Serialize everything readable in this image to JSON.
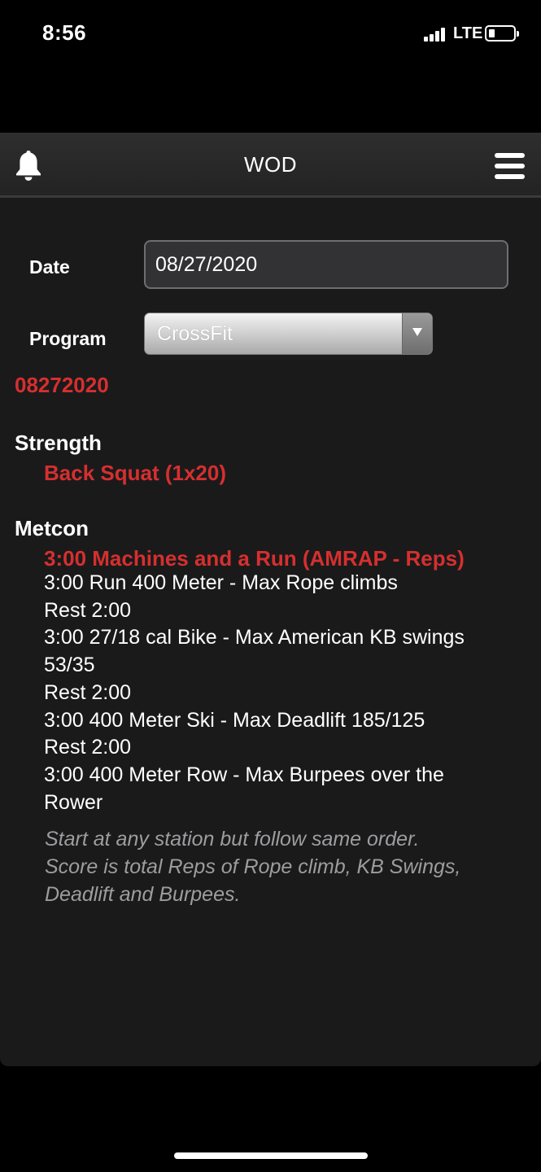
{
  "status": {
    "time": "8:56",
    "network": "LTE"
  },
  "navbar": {
    "title": "WOD"
  },
  "form": {
    "date_label": "Date",
    "date_value": "08/27/2020",
    "program_label": "Program",
    "program_value": "CrossFit"
  },
  "wod": {
    "id": "08272020",
    "sections": [
      {
        "title": "Strength",
        "name": "Back Squat (1x20)"
      },
      {
        "title": "Metcon",
        "name": "3:00 Machines and a Run (AMRAP - Reps)"
      }
    ],
    "metcon_lines": [
      "3:00 Run 400 Meter - Max Rope climbs",
      "Rest 2:00",
      "3:00 27/18 cal Bike - Max American KB swings",
      "53/35",
      "Rest 2:00",
      "3:00 400 Meter Ski - Max Deadlift 185/125",
      "Rest 2:00",
      "3:00 400 Meter Row - Max Burpees over the",
      "Rower"
    ],
    "note_lines": [
      "Start at any station but follow same order.",
      "Score is total Reps of Rope climb, KB Swings,",
      "Deadlift and Burpees."
    ]
  },
  "colors": {
    "accent_red": "#d62f2f",
    "panel_bg": "#1a1a1b",
    "note_gray": "#9d9d9f"
  },
  "icons": {
    "left": "bell-icon",
    "right": "hamburger-menu-icon",
    "select": "dropdown-arrow-icon"
  }
}
